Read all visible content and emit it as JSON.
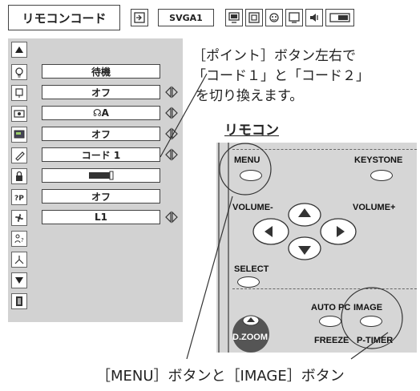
{
  "menu": {
    "title": "リモコンコード",
    "source_label": "SVGA1",
    "toolbar_icons": [
      "input-icon",
      "screen-icon",
      "image-icon",
      "settings-icon",
      "expand-icon",
      "sound-icon",
      "setting-active-icon"
    ]
  },
  "rows": [
    {
      "icon": "lamp-icon",
      "value": "待機",
      "arrow": false
    },
    {
      "icon": "power-icon",
      "value": "オフ",
      "arrow": true
    },
    {
      "icon": "lamp-mode-icon",
      "value": "☊A",
      "arrow": true
    },
    {
      "icon": "screen-icon",
      "value": "オフ",
      "arrow": true
    },
    {
      "icon": "remote-icon",
      "value": "コード 1",
      "arrow": true
    },
    {
      "icon": "lock-icon",
      "value": "",
      "arrow": false
    },
    {
      "icon": "pin-icon",
      "value": "オフ",
      "arrow": false
    },
    {
      "icon": "fan-icon",
      "value": "L1",
      "arrow": true
    }
  ],
  "annotation": {
    "line1": "［ポイント］ボタン左右で",
    "line2": "「コード１」と「コード２」",
    "line3": "を切り換えます。"
  },
  "remote": {
    "title": "リモコン",
    "menu": "MENU",
    "keystone": "KEYSTONE",
    "volume_minus": "VOLUME-",
    "volume_plus": "VOLUME+",
    "select": "SELECT",
    "auto_pc": "AUTO PC",
    "image": "IMAGE",
    "dzoom": "D.ZOOM",
    "freeze": "FREEZE",
    "ptimer": "P-TIMER"
  },
  "caption": "［MENU］ボタンと［IMAGE］ボタン"
}
